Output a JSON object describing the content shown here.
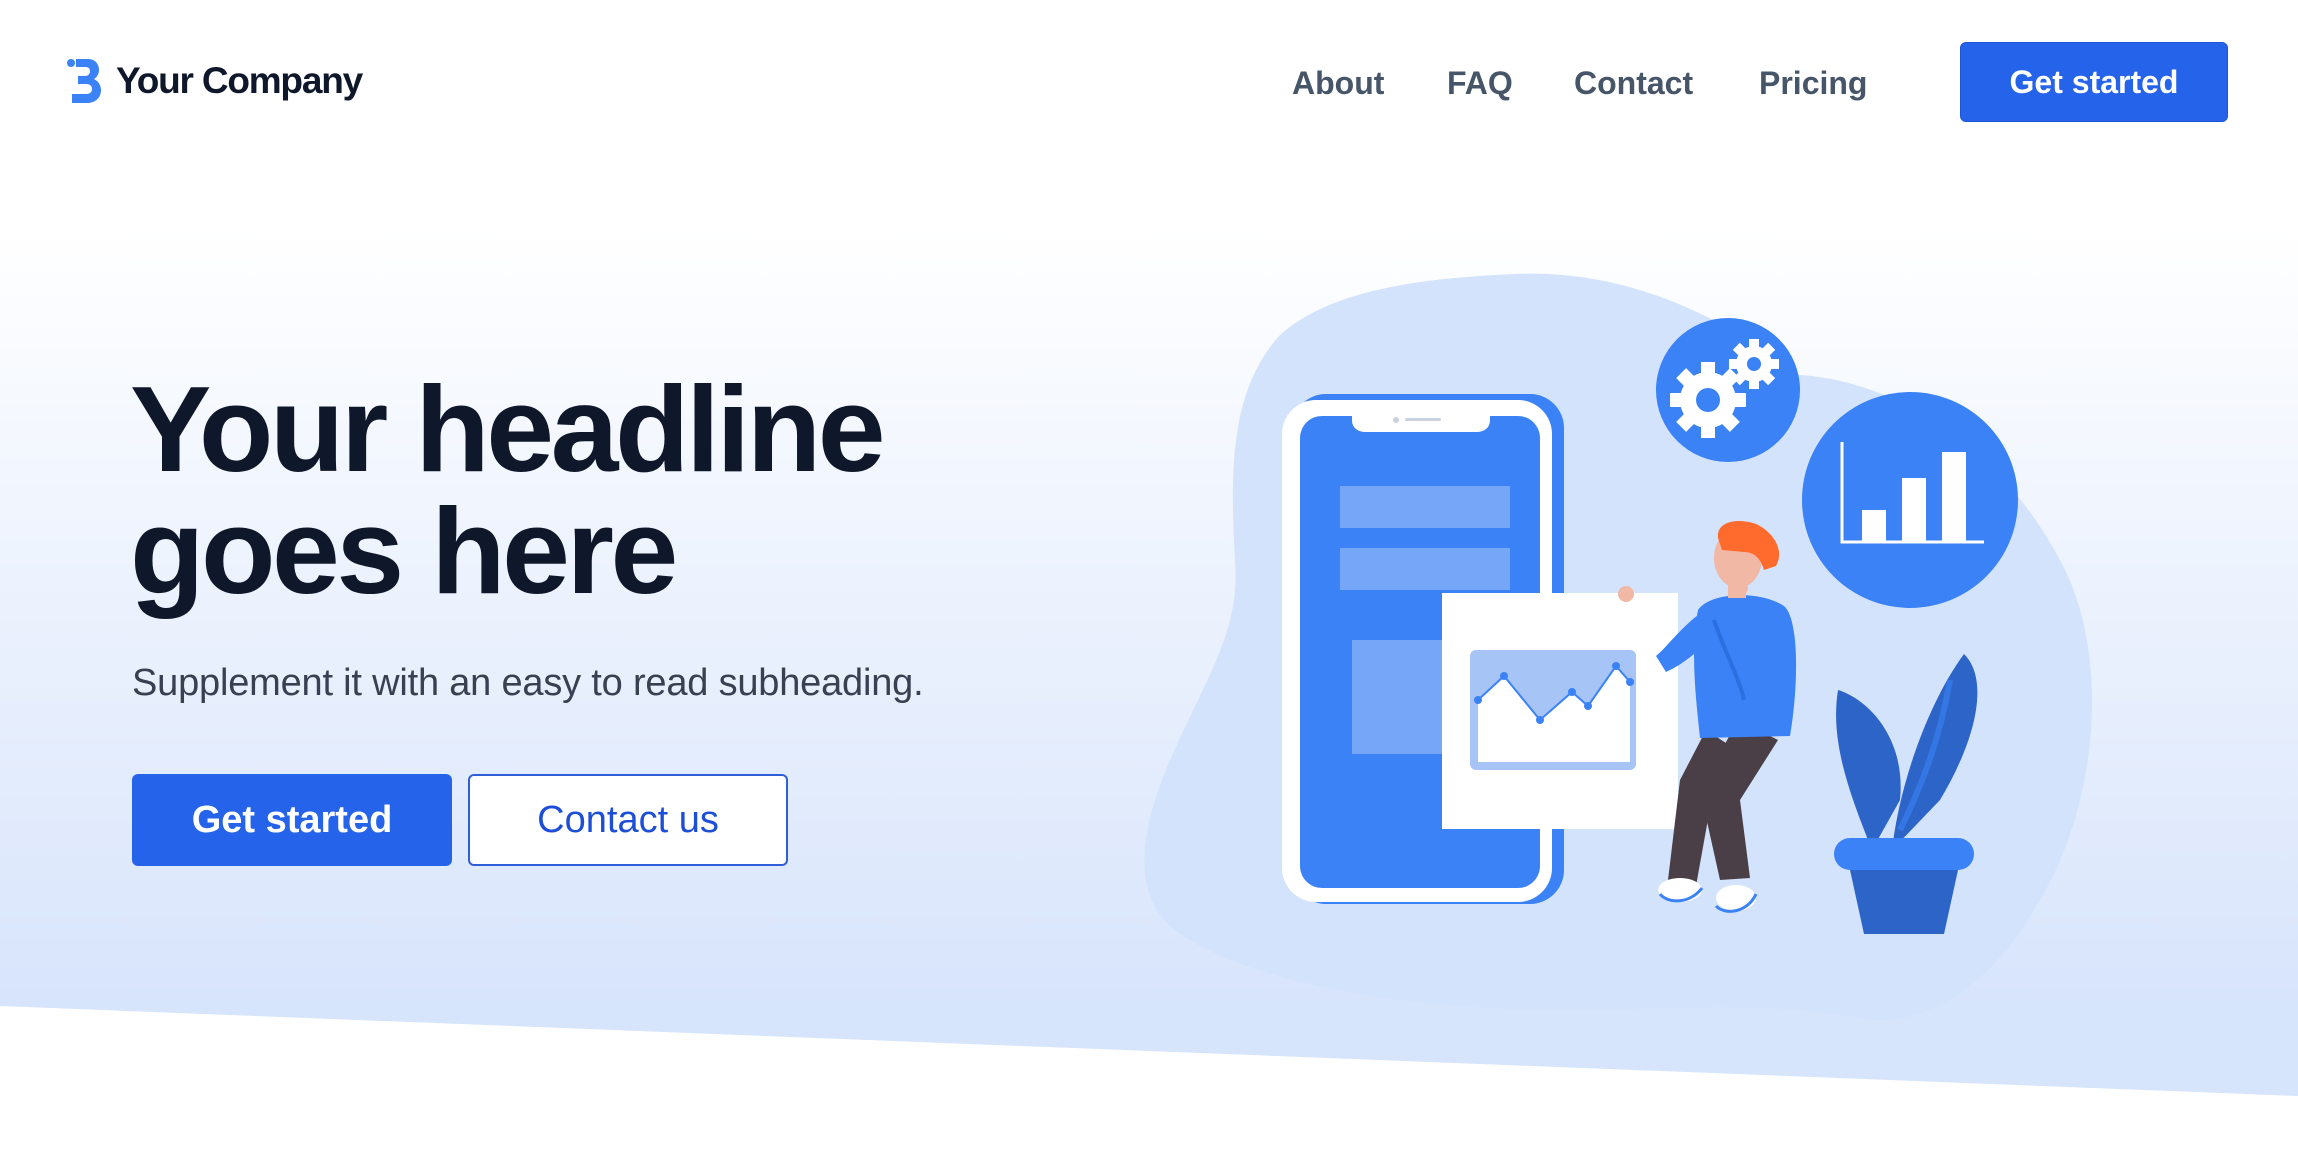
{
  "header": {
    "company_name": "Your Company",
    "nav": [
      {
        "label": "About"
      },
      {
        "label": "FAQ"
      },
      {
        "label": "Contact"
      },
      {
        "label": "Pricing"
      }
    ],
    "cta_label": "Get started"
  },
  "hero": {
    "headline_line1": "Your headline",
    "headline_line2": "goes here",
    "subheading": "Supplement it with an easy to read subheading.",
    "primary_button": "Get started",
    "secondary_button": "Contact us"
  },
  "colors": {
    "brand": "#2563eb",
    "heading": "#0f172a",
    "nav_text": "#475569",
    "illustration_blue": "#3b82f6",
    "blob": "#d4e3fc"
  },
  "icons": [
    "logo-icon",
    "gears-icon",
    "bar-chart-icon",
    "line-chart-icon"
  ]
}
